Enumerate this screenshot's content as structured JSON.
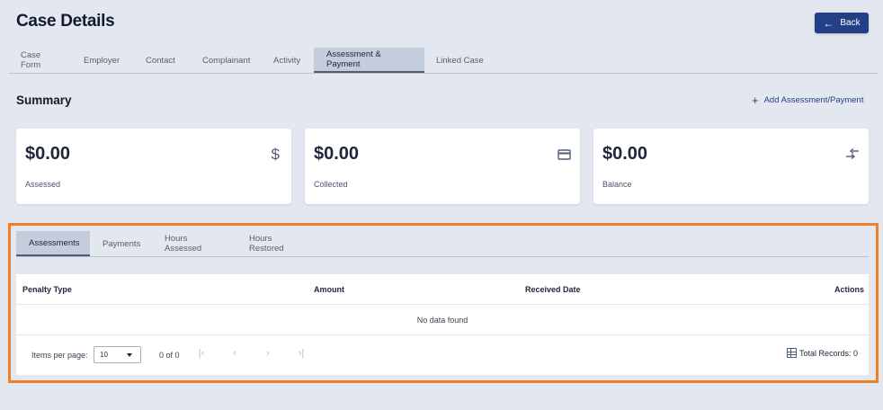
{
  "page": {
    "title": "Case Details"
  },
  "header": {
    "back_label": "Back",
    "back_icon": "arrow-left-icon"
  },
  "tabs": [
    {
      "label": "Case Form"
    },
    {
      "label": "Employer"
    },
    {
      "label": "Contact"
    },
    {
      "label": "Complainant"
    },
    {
      "label": "Activity"
    },
    {
      "label": "Assessment & Payment",
      "active": true
    },
    {
      "label": "Linked Case"
    }
  ],
  "summary": {
    "title": "Summary",
    "add_label": "Add Assessment/Payment",
    "cards": [
      {
        "amount": "$0.00",
        "label": "Assessed",
        "icon": "dollar-icon"
      },
      {
        "amount": "$0.00",
        "label": "Collected",
        "icon": "credit-card-icon"
      },
      {
        "amount": "$0.00",
        "label": "Balance",
        "icon": "compare-arrows-icon"
      }
    ]
  },
  "subtabs": [
    {
      "label": "Assessments",
      "active": true
    },
    {
      "label": "Payments"
    },
    {
      "label": "Hours Assessed"
    },
    {
      "label": "Hours Restored"
    }
  ],
  "table": {
    "columns": [
      "Penalty Type",
      "Amount",
      "Received Date",
      "Actions"
    ],
    "empty_text": "No data found"
  },
  "paginator": {
    "items_per_page_label": "Items per page:",
    "items_per_page": "10",
    "range": "0 of 0",
    "total_label": "Total Records: 0"
  },
  "colors": {
    "primary": "#233f86",
    "highlight_border": "#f07f25",
    "background": "#e3e8f0",
    "active_tab": "#c4cddb"
  }
}
